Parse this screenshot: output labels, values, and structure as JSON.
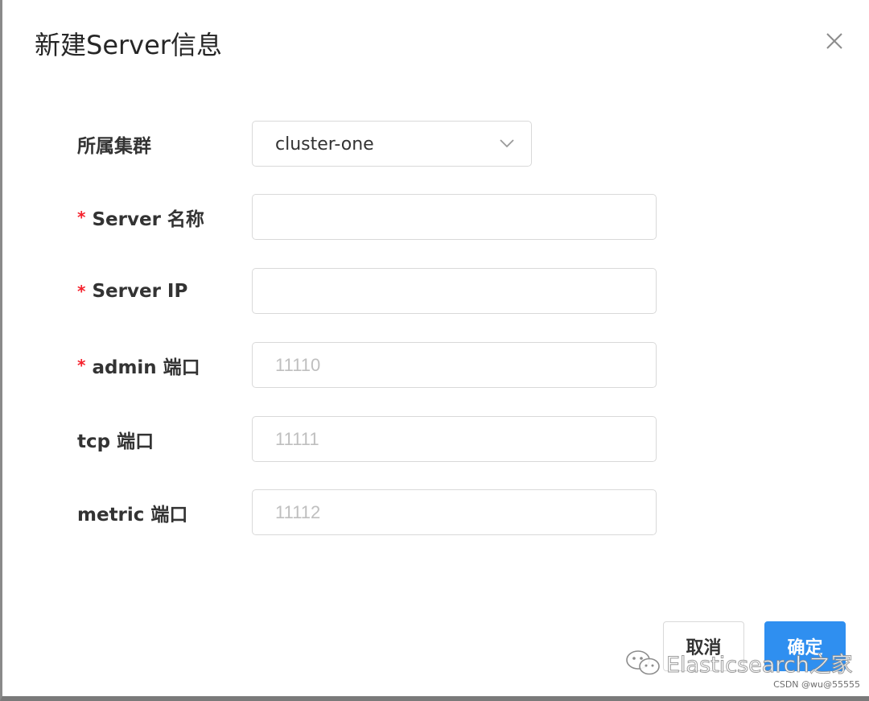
{
  "dialog": {
    "title": "新建Server信息",
    "close_icon": "close-icon"
  },
  "form": {
    "cluster": {
      "label": "所属集群",
      "required": false,
      "value": "cluster-one",
      "arrow_icon": "chevron-down-icon"
    },
    "server_name": {
      "label": "Server 名称",
      "required": true,
      "value": "",
      "placeholder": ""
    },
    "server_ip": {
      "label": "Server IP",
      "required": true,
      "value": "",
      "placeholder": ""
    },
    "admin_port": {
      "label": "admin 端口",
      "required": true,
      "value": "",
      "placeholder": "11110"
    },
    "tcp_port": {
      "label": "tcp 端口",
      "required": false,
      "value": "",
      "placeholder": "11111"
    },
    "metric_port": {
      "label": "metric 端口",
      "required": false,
      "value": "",
      "placeholder": "11112"
    },
    "required_mark": "*"
  },
  "footer": {
    "cancel_label": "取消",
    "confirm_label": "确定"
  },
  "watermark": {
    "text": "Elasticsearch之家",
    "icon": "wechat-icon",
    "csdn": "CSDN @wu@55555"
  },
  "colors": {
    "primary": "#2f8ff0",
    "required": "#f5222d",
    "border": "#d9d9d9",
    "placeholder": "#bfbfbf"
  }
}
